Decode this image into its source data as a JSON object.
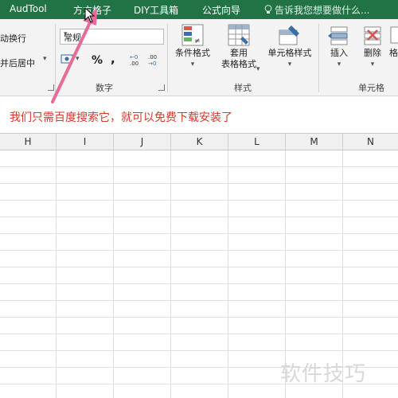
{
  "tabs": [
    "AudTool",
    "方方格子",
    "DIY工具箱",
    "公式向导"
  ],
  "tell_me": "告诉我您想要做什么...",
  "alignment_partial": {
    "wrap": "动换行",
    "merge": "并后居中"
  },
  "number_group": {
    "format_value": "常规",
    "label": "数字",
    "percent": "%",
    "comma": ","
  },
  "styles_group": {
    "conditional": "条件格式",
    "table_line1": "套用",
    "table_line2": "表格格式",
    "cell_styles": "单元格样式",
    "label": "样式"
  },
  "cells_group": {
    "insert": "插入",
    "delete": "删除",
    "format_partial": "格",
    "label": "单元格"
  },
  "annotation": "我们只需百度搜索它，就可以免费下载安装了",
  "columns": [
    "H",
    "I",
    "J",
    "K",
    "L",
    "M",
    "N"
  ],
  "watermark": "软件技巧",
  "colors": {
    "ribbon_tab_bg": "#217346",
    "annotation_text": "#d33a2c",
    "arrow": "#e66a9a"
  }
}
